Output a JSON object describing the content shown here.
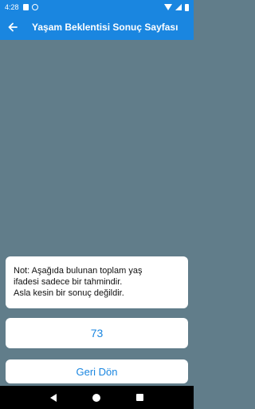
{
  "status_bar": {
    "time": "4:28",
    "icons": [
      "sd-card-icon",
      "sync-icon",
      "wifi-icon",
      "signal-icon",
      "battery-icon"
    ]
  },
  "app_bar": {
    "title": "Yaşam Beklentisi Sonuç Sayfası",
    "back_icon": "arrow-left-icon"
  },
  "note": {
    "text": "Not: Aşağıda bulunan toplam yaş\nifadesi sadece bir tahmindir.\nAsla kesin bir sonuç değildir."
  },
  "result": {
    "value": "73"
  },
  "back_button": {
    "label": "Geri Dön"
  },
  "colors": {
    "primary": "#1a86e0",
    "background": "#617d8a",
    "card": "#ffffff",
    "nav_bar": "#000000"
  },
  "nav_bar": {
    "icons": [
      "nav-back-icon",
      "nav-home-icon",
      "nav-recents-icon"
    ]
  }
}
